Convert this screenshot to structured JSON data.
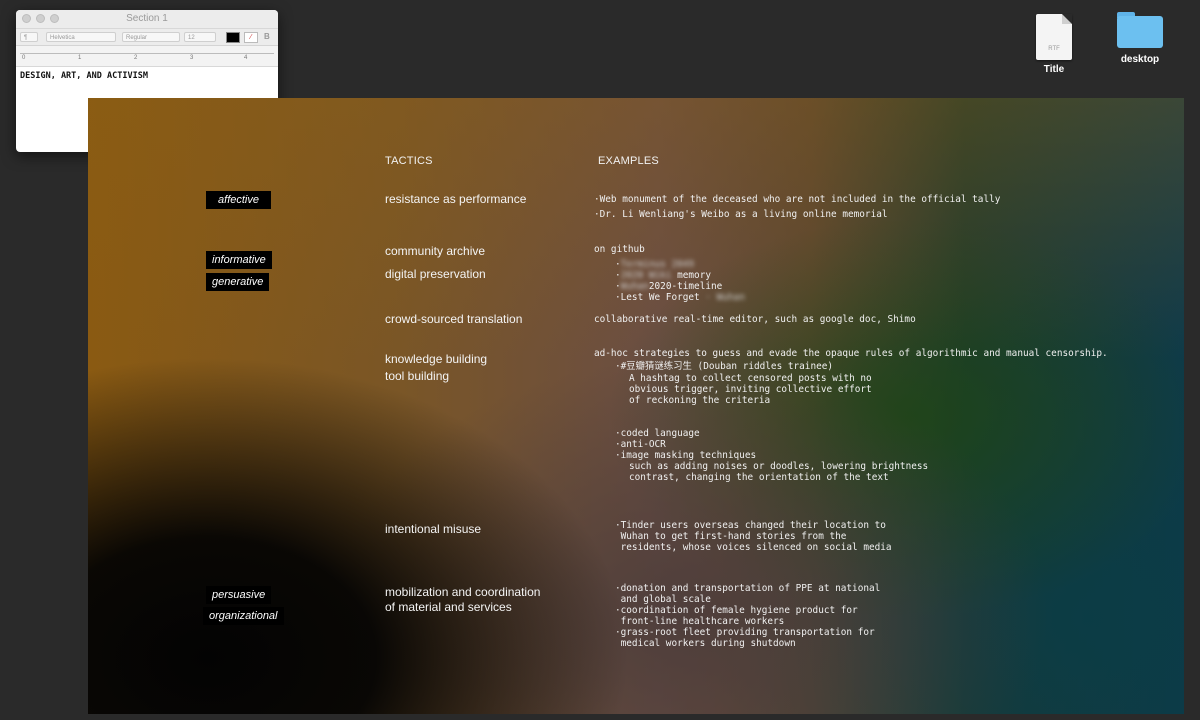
{
  "desktop": {
    "icons": [
      {
        "label": "Title",
        "badge": "RTF",
        "kind": "rtf-document-icon"
      },
      {
        "label": "desktop",
        "kind": "folder-icon"
      }
    ]
  },
  "textedit": {
    "window_title": "Section 1",
    "toolbar": {
      "paragraph": "¶",
      "font_family": "Helvetica",
      "font_style": "Regular",
      "font_size": "12",
      "bold": "B"
    },
    "ruler": [
      "0",
      "1",
      "2",
      "3",
      "4"
    ],
    "document_text": "DESIGN, ART, AND ACTIVISM"
  },
  "slide": {
    "headers": {
      "tactics": "TACTICS",
      "examples": "EXAMPLES"
    },
    "tags": {
      "affective": "affective",
      "informative": "informative",
      "generative": "generative",
      "persuasive": "persuasive",
      "organizational": "organizational"
    },
    "tactics": {
      "resistance": "resistance as performance",
      "community_archive": "community archive",
      "digital_preservation": "digital preservation",
      "translation": "crowd-sourced translation",
      "knowledge": "knowledge building",
      "tool": "tool building",
      "misuse": "intentional misuse",
      "mobilization": "mobilization and coordination\nof material and services"
    },
    "examples": {
      "resistance_1": "·Web monument of the deceased who are not included in the official tally",
      "resistance_2": "·Dr. Li Wenliang's Weibo as a living online memorial",
      "github": "on github",
      "archive_1_blurred": "Terminus 2049",
      "archive_2_blurred": "2020 Wiki",
      "archive_2_visible": "memory",
      "archive_3_blurred": "Wuhan",
      "archive_3_visible": "2020-timeline",
      "archive_4_visible": "·Lest We Forget",
      "archive_4_blurred": "· Wuhan",
      "translation": "collaborative real-time editor, such as google doc, Shimo",
      "knowledge_intro": "ad-hoc strategies to guess and evade the opaque rules of algorithmic and manual censorship.",
      "douban_title": "·#豆瓣猜谜练习生 (Douban riddles trainee)",
      "douban_desc": "A hashtag to collect censored posts with no\nobvious trigger, inviting collective effort\nof reckoning the criteria",
      "techniques": "·coded language\n·anti-OCR\n·image masking techniques",
      "techniques_desc": "such as adding noises or doodles, lowering brightness\ncontrast, changing the orientation of the text",
      "misuse": "·Tinder users overseas changed their location to\n Wuhan to get first-hand stories from the\n residents, whose voices silenced on social media",
      "mobilization": "·donation and transportation of PPE at national\n and global scale\n·coordination of female hygiene product for\n front-line healthcare workers\n·grass-root fleet providing transportation for\n medical workers during shutdown"
    }
  }
}
